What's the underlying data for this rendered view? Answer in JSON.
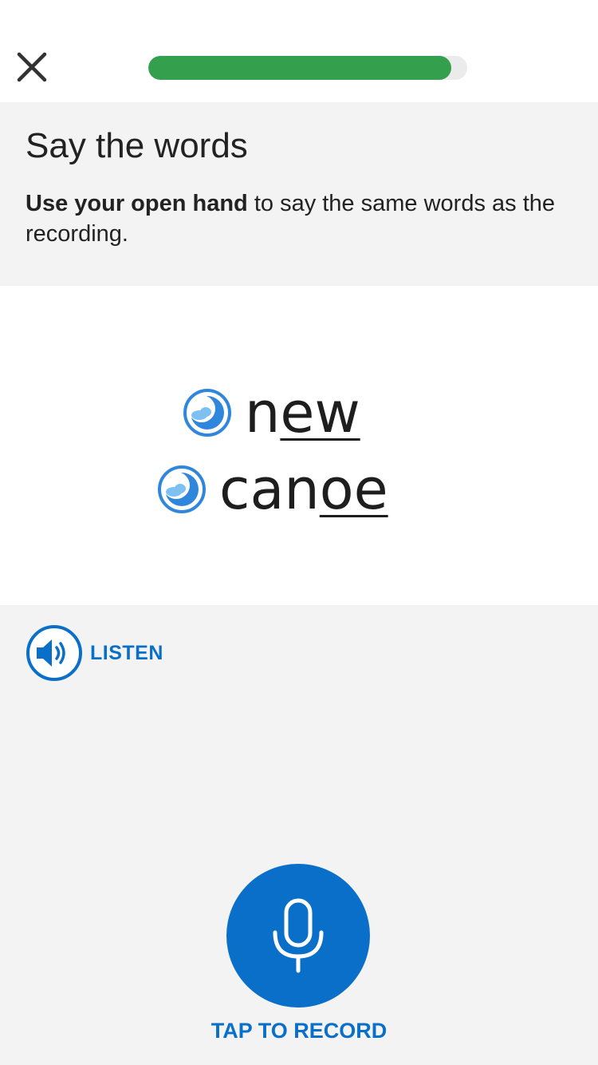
{
  "header": {
    "close_icon": "close-icon",
    "progress": 0.95,
    "progress_color": "#34a04d",
    "progress_track_color": "#ebebeb"
  },
  "instruction": {
    "title": "Say the words",
    "bold_text": "Use your open hand",
    "rest_text": " to say the same words as the recording."
  },
  "words": [
    {
      "icon": "moon-cloud-icon",
      "plain": "n",
      "underlined": "ew"
    },
    {
      "icon": "moon-cloud-icon",
      "plain": "can",
      "underlined": "oe"
    }
  ],
  "listen": {
    "icon": "speaker-icon",
    "label": "LISTEN"
  },
  "record": {
    "icon": "microphone-icon",
    "label": "TAP TO RECORD"
  },
  "colors": {
    "accent": "#0a6fc9",
    "panel_background": "#f3f3f3",
    "icon_light_blue": "#7fc0f2"
  }
}
